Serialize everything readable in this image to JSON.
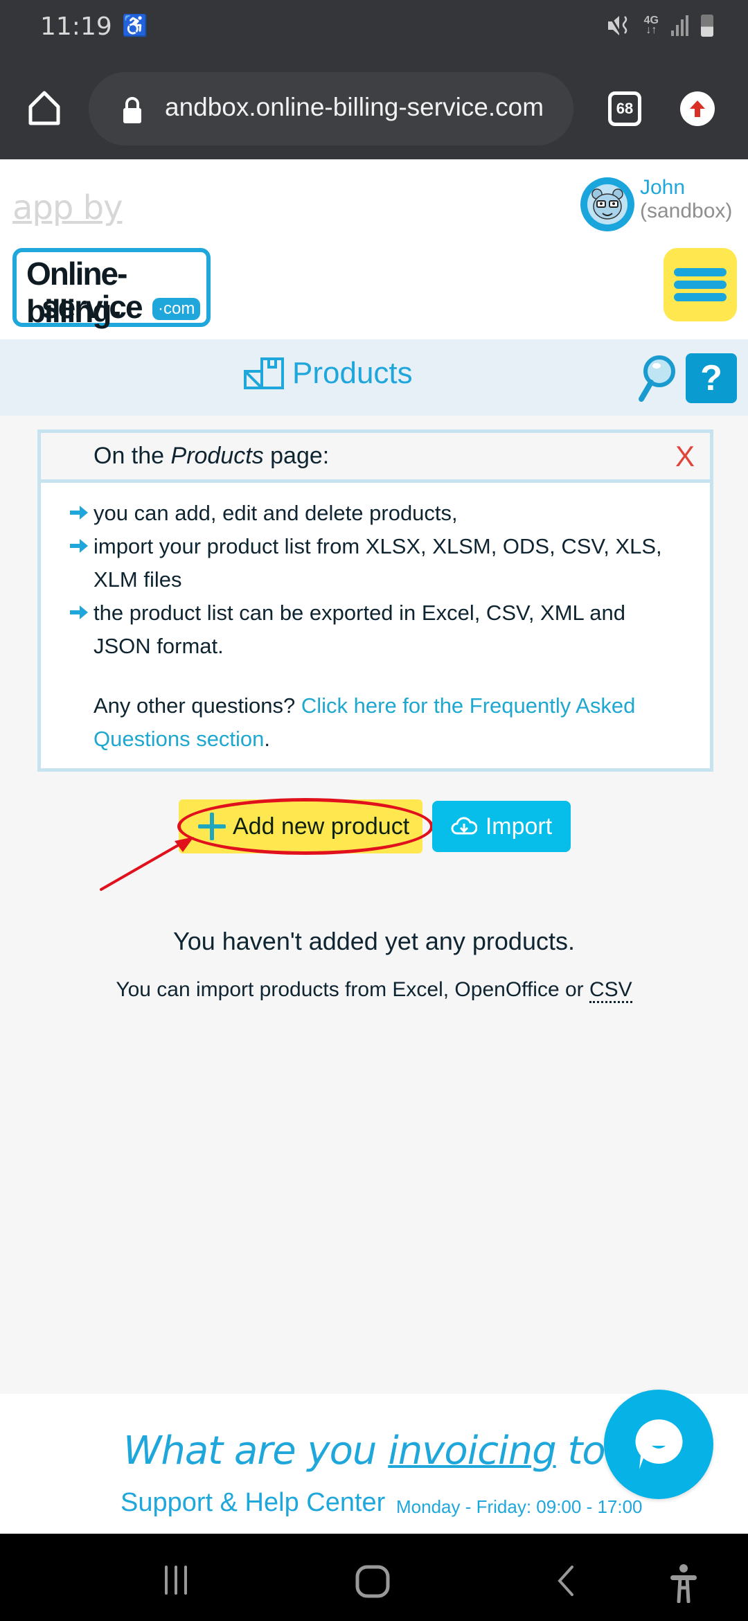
{
  "status_bar": {
    "time": "11:19",
    "network": "4G",
    "icons": [
      "accessibility-icon",
      "mute-vibrate-icon",
      "4g-data-icon",
      "signal-icon",
      "battery-icon"
    ]
  },
  "browser": {
    "url": "andbox.online-billing-service.com",
    "tab_count": "68",
    "icons": [
      "home-icon",
      "lock-icon",
      "tabs-icon",
      "update-icon"
    ]
  },
  "header": {
    "app_by": "app by",
    "logo": {
      "line1": "Online-billing-",
      "line2": "service",
      "suffix": "·com"
    },
    "user": {
      "name": "John",
      "account": "(sandbox)"
    },
    "menu_icon": "hamburger-menu-icon"
  },
  "titlebar": {
    "title": "Products",
    "icon": "products-boxes-icon",
    "search_icon": "magnifier-icon",
    "help_label": "?"
  },
  "info_box": {
    "title_prefix": "On the ",
    "title_emph": "Products",
    "title_suffix": " page:",
    "close_label": "X",
    "bullets": [
      "you can add, edit and delete products,",
      "import your product list from XLSX, XLSM, ODS, CSV, XLS, XLM files",
      "the product list can be exported in Excel, CSV, XML and JSON format."
    ],
    "faq_prefix": "Any other questions? ",
    "faq_link": "Click here for the Frequently Asked Questions section",
    "faq_suffix": "."
  },
  "actions": {
    "add_label": "Add new product",
    "import_label": "Import"
  },
  "empty_state": {
    "title": "You haven't added yet any products.",
    "subtitle_prefix": "You can import products from Excel, OpenOffice or ",
    "subtitle_abbr": "CSV"
  },
  "footer": {
    "slogan_1": "What are you ",
    "slogan_2": "invoicing",
    "slogan_3": " today?",
    "support": "Support & Help Center",
    "hours": "Monday - Friday: 09:00 - 17:00"
  },
  "colors": {
    "brand_blue": "#1fa7dc",
    "yellow": "#ffe84f",
    "import_blue": "#07bde9",
    "close_red": "#e0453a",
    "annotation_red": "#e0101c"
  },
  "navbar": {
    "icons": [
      "recent-apps-icon",
      "home-nav-icon",
      "back-icon",
      "accessibility-nav-icon"
    ]
  }
}
